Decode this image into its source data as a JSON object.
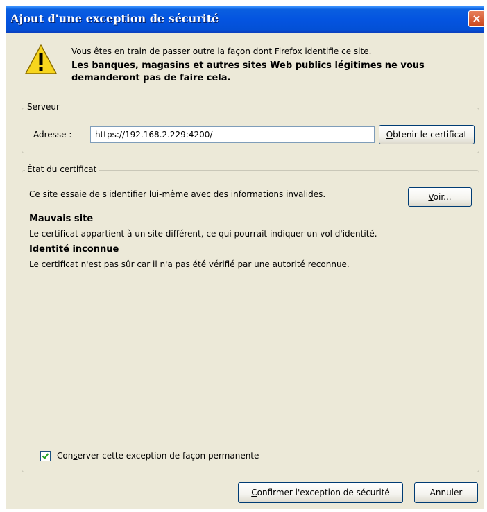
{
  "window": {
    "title": "Ajout d'une exception de sécurité",
    "close_glyph": "×"
  },
  "message": {
    "line1": "Vous êtes en train de passer outre la façon dont Firefox identifie ce site.",
    "line2": "Les banques, magasins et autres sites Web publics légitimes ne vous",
    "line3": "demanderont pas de faire cela."
  },
  "server": {
    "group_label": "Serveur",
    "address_label": "Adresse :",
    "address_value": "https://192.168.2.229:4200/",
    "get_cert_button": {
      "accel": "O",
      "rest": "btenir le certificat"
    }
  },
  "certificate_status": {
    "group_label": "État du certificat",
    "description": "Ce site essaie de s'identifier lui-même avec des informations invalides.",
    "view_button": {
      "accel": "V",
      "rest": "oir..."
    },
    "issues": [
      {
        "title": "Mauvais site",
        "text": "Le certificat appartient à un site différent, ce qui pourrait indiquer un vol d'identité."
      },
      {
        "title": "Identité inconnue",
        "text": "Le certificat n'est pas sûr car il n'a pas été vérifié par une autorité reconnue."
      }
    ]
  },
  "permanent_checkbox": {
    "checked": true,
    "label_prefix": "Con",
    "label_accel": "s",
    "label_rest": "erver cette exception de façon permanente"
  },
  "buttons": {
    "confirm": {
      "accel": "C",
      "rest": "onfirmer l'exception de sécurité"
    },
    "cancel": "Annuler"
  },
  "colors": {
    "titlebar": "#0454e0",
    "dialog_bg": "#ece9d8",
    "warning_yellow": "#f7d51d",
    "checkbox_mark": "#21a121"
  },
  "icons": {
    "warning": "warning-triangle-icon",
    "close": "close-icon",
    "check": "checkmark-icon"
  }
}
